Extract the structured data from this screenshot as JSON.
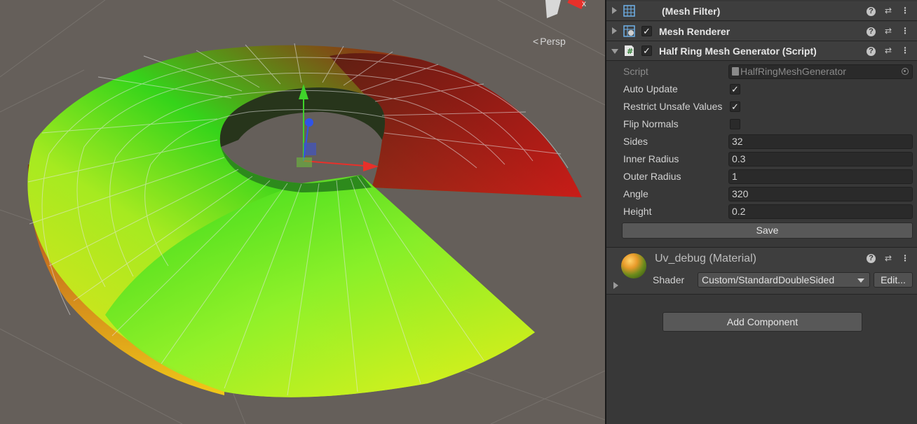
{
  "scene": {
    "projection_label": "Persp",
    "gizmo_axis_label": "x"
  },
  "components": [
    {
      "title": "(Mesh Filter)",
      "icon": "mesh-filter-icon",
      "expanded": false,
      "has_toggle": false
    },
    {
      "title": "Mesh Renderer",
      "icon": "mesh-renderer-icon",
      "expanded": false,
      "has_toggle": true,
      "enabled": true
    },
    {
      "title": "Half Ring Mesh Generator (Script)",
      "icon": "script-icon",
      "expanded": true,
      "has_toggle": true,
      "enabled": true
    }
  ],
  "script_props": {
    "script_label": "Script",
    "script_value": "HalfRingMeshGenerator",
    "auto_update_label": "Auto Update",
    "auto_update": true,
    "restrict_label": "Restrict Unsafe Values",
    "restrict": true,
    "flip_label": "Flip Normals",
    "flip": false,
    "sides_label": "Sides",
    "sides": "32",
    "inner_label": "Inner Radius",
    "inner": "0.3",
    "outer_label": "Outer Radius",
    "outer": "1",
    "angle_label": "Angle",
    "angle": "320",
    "height_label": "Height",
    "height": "0.2",
    "save_label": "Save"
  },
  "material": {
    "title": "Uv_debug (Material)",
    "shader_label": "Shader",
    "shader_value": "Custom/StandardDoubleSided",
    "edit_label": "Edit..."
  },
  "add_component_label": "Add Component",
  "colors": {
    "scene_bg": "#655f5a",
    "inspector_bg": "#383838",
    "header_bg": "#3e3e3e",
    "axis_x": "#e8302a",
    "axis_y": "#3fd32a",
    "axis_z": "#2f54e8"
  }
}
